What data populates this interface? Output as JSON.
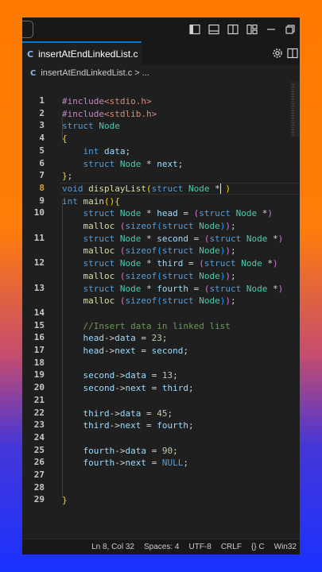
{
  "tab": {
    "filename": "insertAtEndLinkedList.c",
    "lang_badge": "C"
  },
  "breadcrumb": {
    "lang_badge": "C",
    "file": "insertAtEndLinkedList.c",
    "sep": ">",
    "rest": "..."
  },
  "titlebar_icons": [
    "toggle-primary-sidebar-icon",
    "toggle-panel-icon",
    "toggle-secondary-sidebar-icon",
    "customize-layout-icon",
    "minimize-icon",
    "restore-icon"
  ],
  "tab_actions": [
    "settings-icon",
    "split-editor-icon"
  ],
  "editor": {
    "active_line": 8,
    "lines": [
      {
        "n": "1",
        "tokens": [
          [
            "pp",
            "#include"
          ],
          [
            "str",
            "<stdio.h>"
          ]
        ]
      },
      {
        "n": "2",
        "tokens": [
          [
            "pp",
            "#include"
          ],
          [
            "str",
            "<stdlib.h>"
          ]
        ]
      },
      {
        "n": "3",
        "tokens": [
          [
            "kw",
            "struct"
          ],
          [
            "txt",
            " "
          ],
          [
            "ty",
            "Node"
          ]
        ]
      },
      {
        "n": "4",
        "tokens": [
          [
            "bk1",
            "{"
          ]
        ]
      },
      {
        "n": "5",
        "tokens": [
          [
            "txt",
            "    "
          ],
          [
            "kw",
            "int"
          ],
          [
            "txt",
            " "
          ],
          [
            "var",
            "data"
          ],
          [
            "txt",
            ";"
          ]
        ]
      },
      {
        "n": "6",
        "tokens": [
          [
            "txt",
            "    "
          ],
          [
            "kw",
            "struct"
          ],
          [
            "txt",
            " "
          ],
          [
            "ty",
            "Node"
          ],
          [
            "txt",
            " * "
          ],
          [
            "var",
            "next"
          ],
          [
            "txt",
            ";"
          ]
        ]
      },
      {
        "n": "7",
        "tokens": [
          [
            "bk1",
            "}"
          ],
          [
            "txt",
            ";"
          ]
        ]
      },
      {
        "n": "8",
        "tokens": [
          [
            "kw",
            "void"
          ],
          [
            "txt",
            " "
          ],
          [
            "fn",
            "displayList"
          ],
          [
            "bk1",
            "("
          ],
          [
            "kw",
            "struct"
          ],
          [
            "txt",
            " "
          ],
          [
            "ty",
            "Node"
          ],
          [
            "txt",
            " * "
          ],
          [
            "bk1",
            ")"
          ]
        ]
      },
      {
        "n": "9",
        "tokens": [
          [
            "kw",
            "int"
          ],
          [
            "txt",
            " "
          ],
          [
            "fn",
            "main"
          ],
          [
            "bk1",
            "()"
          ],
          [
            "bk1",
            "{"
          ]
        ]
      },
      {
        "n": "10",
        "tokens": [
          [
            "txt",
            "    "
          ],
          [
            "kw",
            "struct"
          ],
          [
            "txt",
            " "
          ],
          [
            "ty",
            "Node"
          ],
          [
            "txt",
            " * "
          ],
          [
            "var",
            "head"
          ],
          [
            "txt",
            " = "
          ],
          [
            "bk2",
            "("
          ],
          [
            "kw",
            "struct"
          ],
          [
            "txt",
            " "
          ],
          [
            "ty",
            "Node"
          ],
          [
            "txt",
            " *"
          ],
          [
            "bk2",
            ")"
          ]
        ]
      },
      {
        "n": "",
        "tokens": [
          [
            "txt",
            "    "
          ],
          [
            "fn",
            "malloc"
          ],
          [
            "txt",
            " "
          ],
          [
            "bk2",
            "("
          ],
          [
            "kw",
            "sizeof"
          ],
          [
            "bk3",
            "("
          ],
          [
            "kw",
            "struct"
          ],
          [
            "txt",
            " "
          ],
          [
            "ty",
            "Node"
          ],
          [
            "bk3",
            ")"
          ],
          [
            "bk2",
            ")"
          ],
          [
            "txt",
            ";"
          ]
        ]
      },
      {
        "n": "11",
        "tokens": [
          [
            "txt",
            "    "
          ],
          [
            "kw",
            "struct"
          ],
          [
            "txt",
            " "
          ],
          [
            "ty",
            "Node"
          ],
          [
            "txt",
            " * "
          ],
          [
            "var",
            "second"
          ],
          [
            "txt",
            " = "
          ],
          [
            "bk2",
            "("
          ],
          [
            "kw",
            "struct"
          ],
          [
            "txt",
            " "
          ],
          [
            "ty",
            "Node"
          ],
          [
            "txt",
            " *"
          ],
          [
            "bk2",
            ")"
          ]
        ]
      },
      {
        "n": "",
        "tokens": [
          [
            "txt",
            "    "
          ],
          [
            "fn",
            "malloc"
          ],
          [
            "txt",
            " "
          ],
          [
            "bk2",
            "("
          ],
          [
            "kw",
            "sizeof"
          ],
          [
            "bk3",
            "("
          ],
          [
            "kw",
            "struct"
          ],
          [
            "txt",
            " "
          ],
          [
            "ty",
            "Node"
          ],
          [
            "bk3",
            ")"
          ],
          [
            "bk2",
            ")"
          ],
          [
            "txt",
            ";"
          ]
        ]
      },
      {
        "n": "12",
        "tokens": [
          [
            "txt",
            "    "
          ],
          [
            "kw",
            "struct"
          ],
          [
            "txt",
            " "
          ],
          [
            "ty",
            "Node"
          ],
          [
            "txt",
            " * "
          ],
          [
            "var",
            "third"
          ],
          [
            "txt",
            " = "
          ],
          [
            "bk2",
            "("
          ],
          [
            "kw",
            "struct"
          ],
          [
            "txt",
            " "
          ],
          [
            "ty",
            "Node"
          ],
          [
            "txt",
            " *"
          ],
          [
            "bk2",
            ")"
          ]
        ]
      },
      {
        "n": "",
        "tokens": [
          [
            "txt",
            "    "
          ],
          [
            "fn",
            "malloc"
          ],
          [
            "txt",
            " "
          ],
          [
            "bk2",
            "("
          ],
          [
            "kw",
            "sizeof"
          ],
          [
            "bk3",
            "("
          ],
          [
            "kw",
            "struct"
          ],
          [
            "txt",
            " "
          ],
          [
            "ty",
            "Node"
          ],
          [
            "bk3",
            ")"
          ],
          [
            "bk2",
            ")"
          ],
          [
            "txt",
            ";"
          ]
        ]
      },
      {
        "n": "13",
        "tokens": [
          [
            "txt",
            "    "
          ],
          [
            "kw",
            "struct"
          ],
          [
            "txt",
            " "
          ],
          [
            "ty",
            "Node"
          ],
          [
            "txt",
            " * "
          ],
          [
            "var",
            "fourth"
          ],
          [
            "txt",
            " = "
          ],
          [
            "bk2",
            "("
          ],
          [
            "kw",
            "struct"
          ],
          [
            "txt",
            " "
          ],
          [
            "ty",
            "Node"
          ],
          [
            "txt",
            " *"
          ],
          [
            "bk2",
            ")"
          ]
        ]
      },
      {
        "n": "",
        "tokens": [
          [
            "txt",
            "    "
          ],
          [
            "fn",
            "malloc"
          ],
          [
            "txt",
            " "
          ],
          [
            "bk2",
            "("
          ],
          [
            "kw",
            "sizeof"
          ],
          [
            "bk3",
            "("
          ],
          [
            "kw",
            "struct"
          ],
          [
            "txt",
            " "
          ],
          [
            "ty",
            "Node"
          ],
          [
            "bk3",
            ")"
          ],
          [
            "bk2",
            ")"
          ],
          [
            "txt",
            ";"
          ]
        ]
      },
      {
        "n": "14",
        "tokens": []
      },
      {
        "n": "15",
        "tokens": [
          [
            "txt",
            "    "
          ],
          [
            "cm",
            "//Insert data in linked list"
          ]
        ]
      },
      {
        "n": "16",
        "tokens": [
          [
            "txt",
            "    "
          ],
          [
            "var",
            "head"
          ],
          [
            "txt",
            "->"
          ],
          [
            "var",
            "data"
          ],
          [
            "txt",
            " = "
          ],
          [
            "num",
            "23"
          ],
          [
            "txt",
            ";"
          ]
        ]
      },
      {
        "n": "17",
        "tokens": [
          [
            "txt",
            "    "
          ],
          [
            "var",
            "head"
          ],
          [
            "txt",
            "->"
          ],
          [
            "var",
            "next"
          ],
          [
            "txt",
            " = "
          ],
          [
            "var",
            "second"
          ],
          [
            "txt",
            ";"
          ]
        ]
      },
      {
        "n": "18",
        "tokens": []
      },
      {
        "n": "19",
        "tokens": [
          [
            "txt",
            "    "
          ],
          [
            "var",
            "second"
          ],
          [
            "txt",
            "->"
          ],
          [
            "var",
            "data"
          ],
          [
            "txt",
            " = "
          ],
          [
            "num",
            "13"
          ],
          [
            "txt",
            ";"
          ]
        ]
      },
      {
        "n": "20",
        "tokens": [
          [
            "txt",
            "    "
          ],
          [
            "var",
            "second"
          ],
          [
            "txt",
            "->"
          ],
          [
            "var",
            "next"
          ],
          [
            "txt",
            " = "
          ],
          [
            "var",
            "third"
          ],
          [
            "txt",
            ";"
          ]
        ]
      },
      {
        "n": "21",
        "tokens": []
      },
      {
        "n": "22",
        "tokens": [
          [
            "txt",
            "    "
          ],
          [
            "var",
            "third"
          ],
          [
            "txt",
            "->"
          ],
          [
            "var",
            "data"
          ],
          [
            "txt",
            " = "
          ],
          [
            "num",
            "45"
          ],
          [
            "txt",
            ";"
          ]
        ]
      },
      {
        "n": "23",
        "tokens": [
          [
            "txt",
            "    "
          ],
          [
            "var",
            "third"
          ],
          [
            "txt",
            "->"
          ],
          [
            "var",
            "next"
          ],
          [
            "txt",
            " = "
          ],
          [
            "var",
            "fourth"
          ],
          [
            "txt",
            ";"
          ]
        ]
      },
      {
        "n": "24",
        "tokens": []
      },
      {
        "n": "25",
        "tokens": [
          [
            "txt",
            "    "
          ],
          [
            "var",
            "fourth"
          ],
          [
            "txt",
            "->"
          ],
          [
            "var",
            "data"
          ],
          [
            "txt",
            " = "
          ],
          [
            "num",
            "90"
          ],
          [
            "txt",
            ";"
          ]
        ]
      },
      {
        "n": "26",
        "tokens": [
          [
            "txt",
            "    "
          ],
          [
            "var",
            "fourth"
          ],
          [
            "txt",
            "->"
          ],
          [
            "var",
            "next"
          ],
          [
            "txt",
            " = "
          ],
          [
            "kw",
            "NULL"
          ],
          [
            "txt",
            ";"
          ]
        ]
      },
      {
        "n": "27",
        "tokens": []
      },
      {
        "n": "28",
        "tokens": []
      },
      {
        "n": "29",
        "tokens": [
          [
            "bk1",
            "}"
          ]
        ]
      }
    ]
  },
  "status": {
    "position": "Ln 8, Col 32",
    "indent": "Spaces: 4",
    "encoding": "UTF-8",
    "eol": "CRLF",
    "language": "{} C",
    "platform": "Win32"
  }
}
